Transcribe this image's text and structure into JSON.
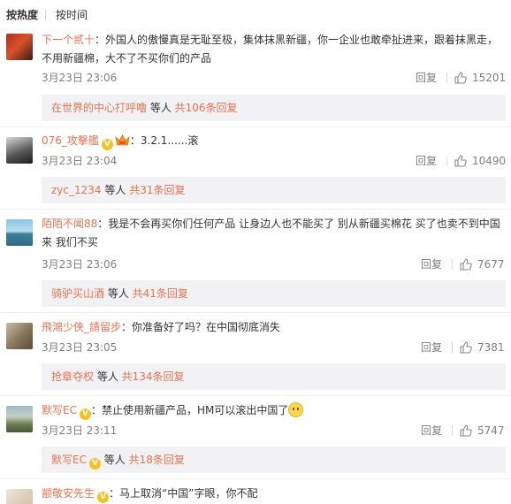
{
  "sort": {
    "hot": "按热度",
    "time": "按时间"
  },
  "comments": [
    {
      "user": "下一个贰十",
      "text": "：外国人的傲慢真是无耻至极，集体抹黑新疆，你一企业也敢牵扯进来，跟着抹黑走，",
      "text2": "不用新疆棉，大不了不买你们的产品",
      "time": "3月23日 23:06",
      "reply": "回复",
      "likes": "15201",
      "sub_user": "在世界的中心打呼噜",
      "sub_mid": " 等人 ",
      "sub_count": "共106条回复"
    },
    {
      "user": "076_攻擊艦",
      "text": "：3.2.1......滚",
      "time": "3月23日 23:04",
      "reply": "回复",
      "likes": "10490",
      "sub_user": "zyc_1234",
      "sub_mid": " 等人 ",
      "sub_count": "共31条回复"
    },
    {
      "user": "陌陌不闻88",
      "text": "：我是不会再买你们任何产品 让身边人也不能买了 别从新疆买棉花 买了也卖不到中国",
      "text2": "来 我们不买",
      "time": "3月23日 23:06",
      "reply": "回复",
      "likes": "7677",
      "sub_user": "骑驴买山酒",
      "sub_mid": " 等人 ",
      "sub_count": "共41条回复"
    },
    {
      "user": "飛鴻少俠_請留步",
      "text": "：你准备好了吗？在中国彻底消失",
      "time": "3月23日 23:05",
      "reply": "回复",
      "likes": "7381",
      "sub_user": "抢章夺权",
      "sub_mid": " 等人 ",
      "sub_count": "共134条回复"
    },
    {
      "user": "默写EC",
      "text": "：禁止使用新疆产品，HM可以滚出中国了",
      "time": "3月23日 23:11",
      "reply": "回复",
      "likes": "5747",
      "sub_user": "默写EC",
      "sub_mid": " 等人 ",
      "sub_count": "共18条回复"
    },
    {
      "user": "颛敬安先生",
      "text": "：马上取消“中国”字眼，你不配"
    }
  ],
  "colors": {
    "accent": "#eb7350",
    "meta": "#808080",
    "subbox": "#f2f2f5"
  },
  "icons": [
    "thumbs-up-icon",
    "verified-badge-icon",
    "crown-icon",
    "smile-emoji-icon"
  ]
}
